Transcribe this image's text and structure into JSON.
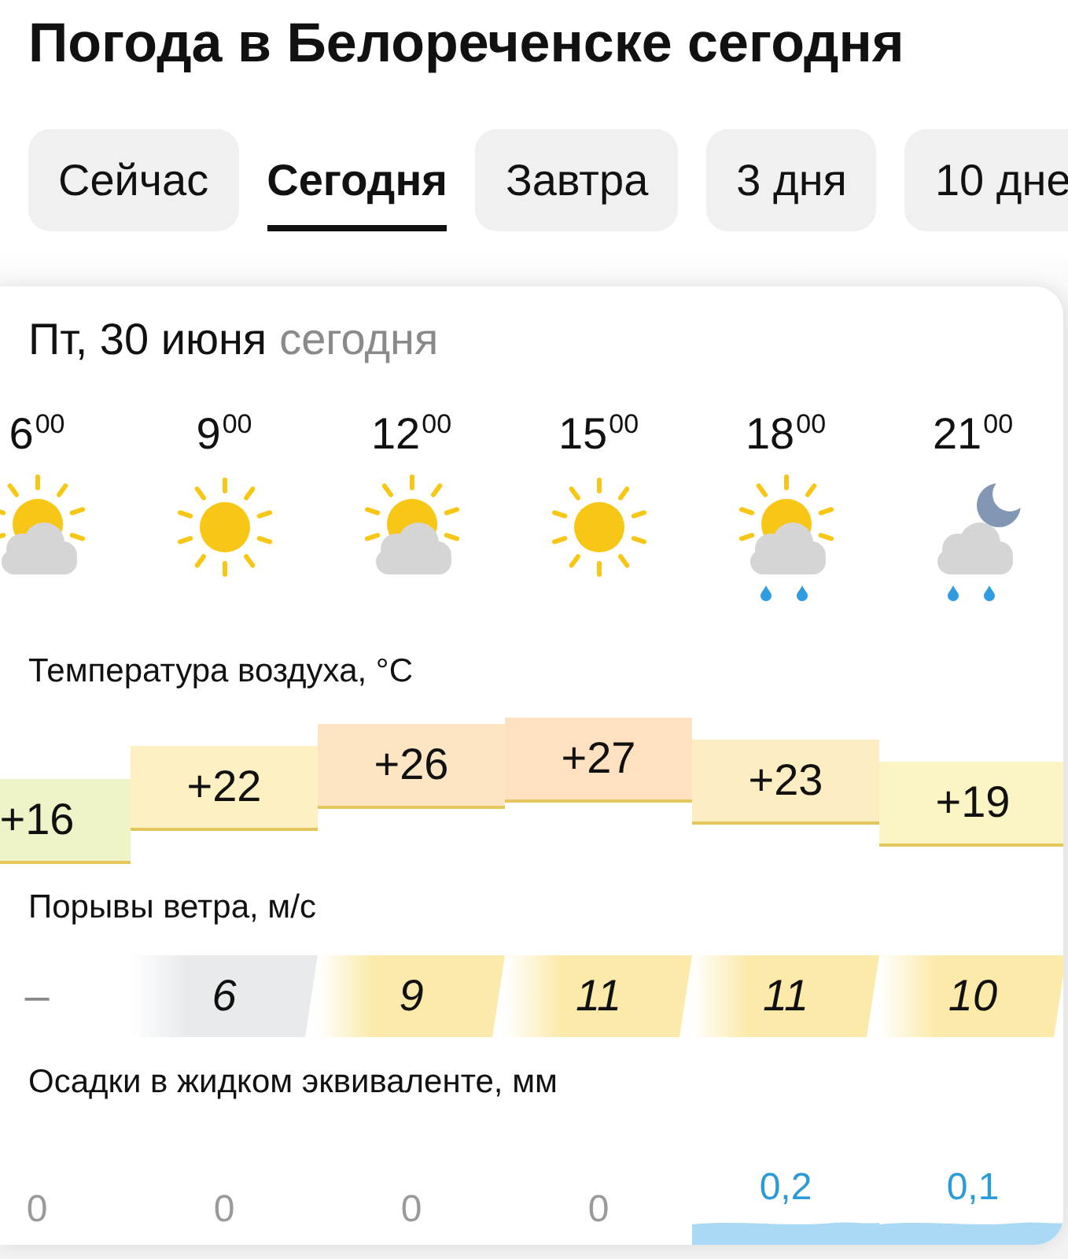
{
  "title": "Погода в Белореченске сегодня",
  "tabs": [
    {
      "label": "Сейчас",
      "selected": false
    },
    {
      "label": "Сегодня",
      "selected": true
    },
    {
      "label": "Завтра",
      "selected": false
    },
    {
      "label": "3 дня",
      "selected": false
    },
    {
      "label": "10 дне",
      "selected": false
    }
  ],
  "forecast": {
    "date": "Пт, 30 июня",
    "day_label": "сегодня",
    "hours": [
      {
        "time": "6$^{00}$",
        "kind": "partly-cloudy"
      },
      {
        "time": "9$^{00}$",
        "kind": "sunny"
      },
      {
        "time": "12$^{00}$",
        "kind": "partly-cloudy"
      },
      {
        "time": "15$^{00}$",
        "kind": "sunny"
      },
      {
        "time": "18$^{00}$",
        "kind": "partly-cloudy-rain"
      },
      {
        "time": "21$^{00}$",
        "kind": "night-cloudy-rain"
      }
    ],
    "temperature": {
      "label": "Температура воздуха, °C",
      "values": [
        {
          "value": "+16",
          "color": "#eef3c8"
        },
        {
          "value": "+22",
          "color": "#fdf0c3"
        },
        {
          "value": "+26",
          "color": "#fde5c4"
        },
        {
          "value": "+27",
          "color": "#fde1c1"
        },
        {
          "value": "+23",
          "color": "#fdedc3"
        },
        {
          "value": "+19",
          "color": "#fbf4c4"
        }
      ]
    },
    "wind": {
      "label": "Порывы ветра, м/с",
      "values": [
        {
          "value": "–"
        },
        {
          "value": "6",
          "color": "#e8eaec"
        },
        {
          "value": "9",
          "color": "#fbeaa9"
        },
        {
          "value": "11",
          "color": "#fbeaa9"
        },
        {
          "value": "11",
          "color": "#fbeaa9"
        },
        {
          "value": "10",
          "color": "#fbeaa9"
        }
      ]
    },
    "precipitation": {
      "label": "Осадки в жидком эквиваленте, мм",
      "values": [
        {
          "value": "0",
          "kind": "dry"
        },
        {
          "value": "0",
          "kind": "dry"
        },
        {
          "value": "0",
          "kind": "dry"
        },
        {
          "value": "0",
          "kind": "dry"
        },
        {
          "value": "0,2",
          "kind": "wet"
        },
        {
          "value": "0,1",
          "kind": "wet"
        }
      ]
    }
  }
}
